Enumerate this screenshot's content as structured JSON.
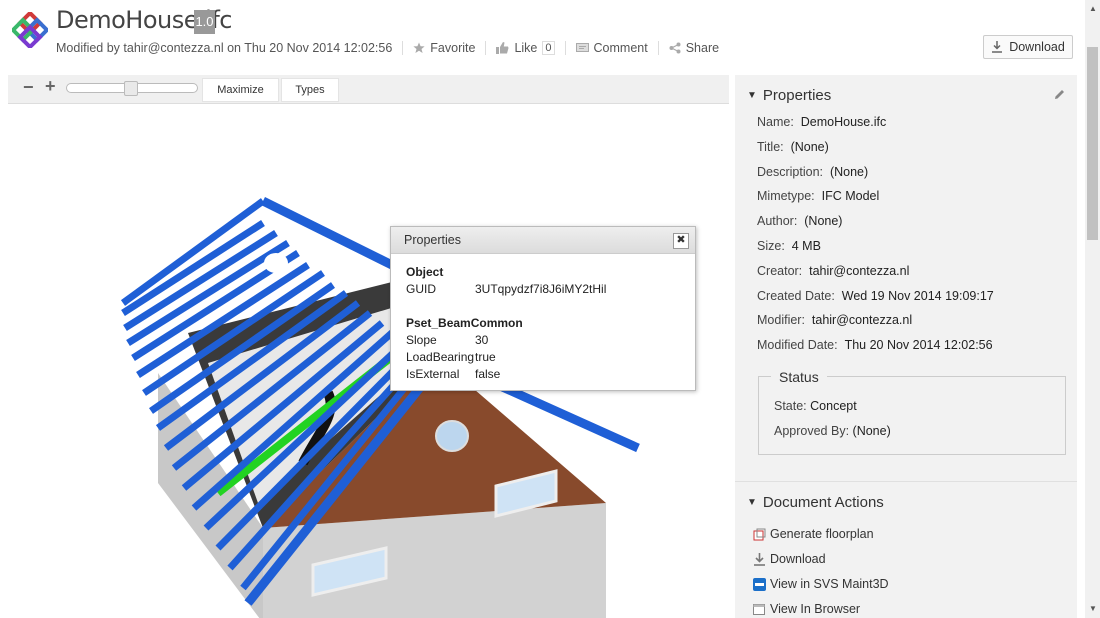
{
  "header": {
    "title": "DemoHouse.ifc",
    "version": "1.0",
    "modified": "Modified by tahir@contezza.nl on Thu 20 Nov 2014 12:02:56",
    "favorite": "Favorite",
    "like": "Like",
    "like_count": "0",
    "comment": "Comment",
    "share": "Share",
    "download": "Download"
  },
  "viewer": {
    "zoom_out": "−",
    "zoom_in": "+",
    "zoom_level": 0.5,
    "maximize": "Maximize",
    "types": "Types"
  },
  "popup": {
    "title": "Properties",
    "close": "✖",
    "section1": "Object",
    "guid_key": "GUID",
    "guid_val": "3UTqpydzf7i8J6iMY2tHil",
    "section2": "Pset_BeamCommon",
    "slope_key": "Slope",
    "slope_val": "30",
    "lb_key": "LoadBearing",
    "lb_val": "true",
    "ext_key": "IsExternal",
    "ext_val": "false"
  },
  "properties": {
    "heading": "Properties",
    "items": [
      {
        "label": "Name:",
        "value": "DemoHouse.ifc"
      },
      {
        "label": "Title:",
        "value": "(None)"
      },
      {
        "label": "Description:",
        "value": "(None)"
      },
      {
        "label": "Mimetype:",
        "value": "IFC Model"
      },
      {
        "label": "Author:",
        "value": "(None)"
      },
      {
        "label": "Size:",
        "value": "4 MB"
      },
      {
        "label": "Creator:",
        "value": "tahir@contezza.nl"
      },
      {
        "label": "Created Date:",
        "value": "Wed 19 Nov 2014 19:09:17"
      },
      {
        "label": "Modifier:",
        "value": "tahir@contezza.nl"
      },
      {
        "label": "Modified Date:",
        "value": "Thu 20 Nov 2014 12:02:56"
      }
    ],
    "status_heading": "Status",
    "state_label": "State:",
    "state_value": "Concept",
    "approved_label": "Approved By:",
    "approved_value": "(None)"
  },
  "actions": {
    "heading": "Document Actions",
    "items": [
      {
        "label": "Generate floorplan",
        "icon": "floorplan-icon"
      },
      {
        "label": "Download",
        "icon": "download-icon"
      },
      {
        "label": "View in SVS Maint3D",
        "icon": "svs-icon"
      },
      {
        "label": "View In Browser",
        "icon": "browser-icon"
      }
    ]
  },
  "colors": {
    "beam_blue": "#1f5fd6",
    "highlight_green": "#22d322",
    "roof_brown": "#8a4a2a"
  }
}
